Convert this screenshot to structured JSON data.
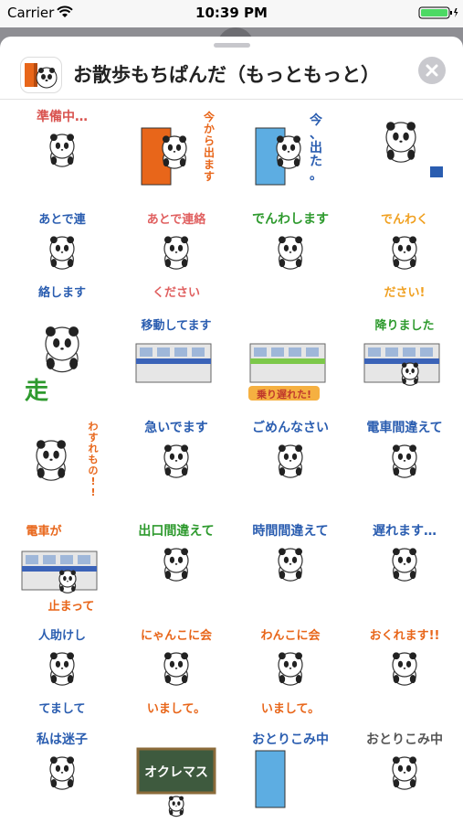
{
  "status_bar": {
    "carrier": "Carrier",
    "time": "10:39 PM"
  },
  "header": {
    "title": "お散歩もちぱんだ（もっともっと）"
  },
  "colors": {
    "sheet_bg": "#ffffff",
    "backdrop": "#8e8e93",
    "close_button_bg": "#c9c9ce",
    "battery": "#4cd964"
  },
  "stickers": [
    {
      "text": "準備中…",
      "color": "#d9534f",
      "icon": "panda-packing"
    },
    {
      "text": "今から出ます",
      "color": "#e8661a",
      "icon": "panda-door"
    },
    {
      "text": "今、出た。",
      "color": "#2a5db0",
      "icon": "panda-door-blue"
    },
    {
      "text": "",
      "color": "#333333",
      "icon": "panda-running"
    },
    {
      "text": "あとで連絡します",
      "color": "#2a5db0",
      "icon": "panda-phone"
    },
    {
      "text": "あとで連絡ください",
      "color": "#e06060",
      "icon": "panda-phone"
    },
    {
      "text": "でんわします",
      "color": "#2e9a2e",
      "icon": "panda-telephone"
    },
    {
      "text": "でんわください!",
      "color": "#f0a020",
      "icon": "panda-telephone"
    },
    {
      "text": "走",
      "color": "#2e9a2e",
      "icon": "panda-run"
    },
    {
      "text": "移動してます",
      "color": "#2a5db0",
      "icon": "train"
    },
    {
      "text": "乗り遅れた!",
      "color": "#e8661a",
      "icon": "train-green"
    },
    {
      "text": "降りました",
      "color": "#2e9a2e",
      "icon": "train-panda"
    },
    {
      "text": "わすれもの!!",
      "color": "#e8661a",
      "icon": "panda-forgot"
    },
    {
      "text": "急いでます",
      "color": "#2a5db0",
      "icon": "panda-hurry"
    },
    {
      "text": "ごめんなさい",
      "color": "#2a5db0",
      "icon": "panda-sorry"
    },
    {
      "text": "電車間違えて",
      "color": "#2a5db0",
      "icon": "panda-wrong-train"
    },
    {
      "text": "電車が止まって",
      "color": "#e8661a",
      "icon": "train-stopped"
    },
    {
      "text": "出口間違えて",
      "color": "#2e9a2e",
      "icon": "panda-exit"
    },
    {
      "text": "時間間違えて",
      "color": "#2a5db0",
      "icon": "panda-time"
    },
    {
      "text": "遅れます…",
      "color": "#2a5db0",
      "icon": "panda-late"
    },
    {
      "text": "人助けしてまして",
      "color": "#2a5db0",
      "icon": "panda-help"
    },
    {
      "text": "にゃんこに会いまして。",
      "color": "#e8661a",
      "icon": "panda-cat"
    },
    {
      "text": "わんこに会いまして。",
      "color": "#e8661a",
      "icon": "panda-dog"
    },
    {
      "text": "おくれます!!",
      "color": "#e8661a",
      "icon": "panda-late-bird"
    },
    {
      "text": "私は迷子",
      "color": "#2a5db0",
      "icon": "panda-lost"
    },
    {
      "text": "オクレマス",
      "color": "#ffffff",
      "icon": "blackboard"
    },
    {
      "text": "おとりこみ中",
      "color": "#2a5db0",
      "icon": "door-blue"
    },
    {
      "text": "おとりこみ中",
      "color": "#555555",
      "icon": "panda-busy"
    }
  ]
}
